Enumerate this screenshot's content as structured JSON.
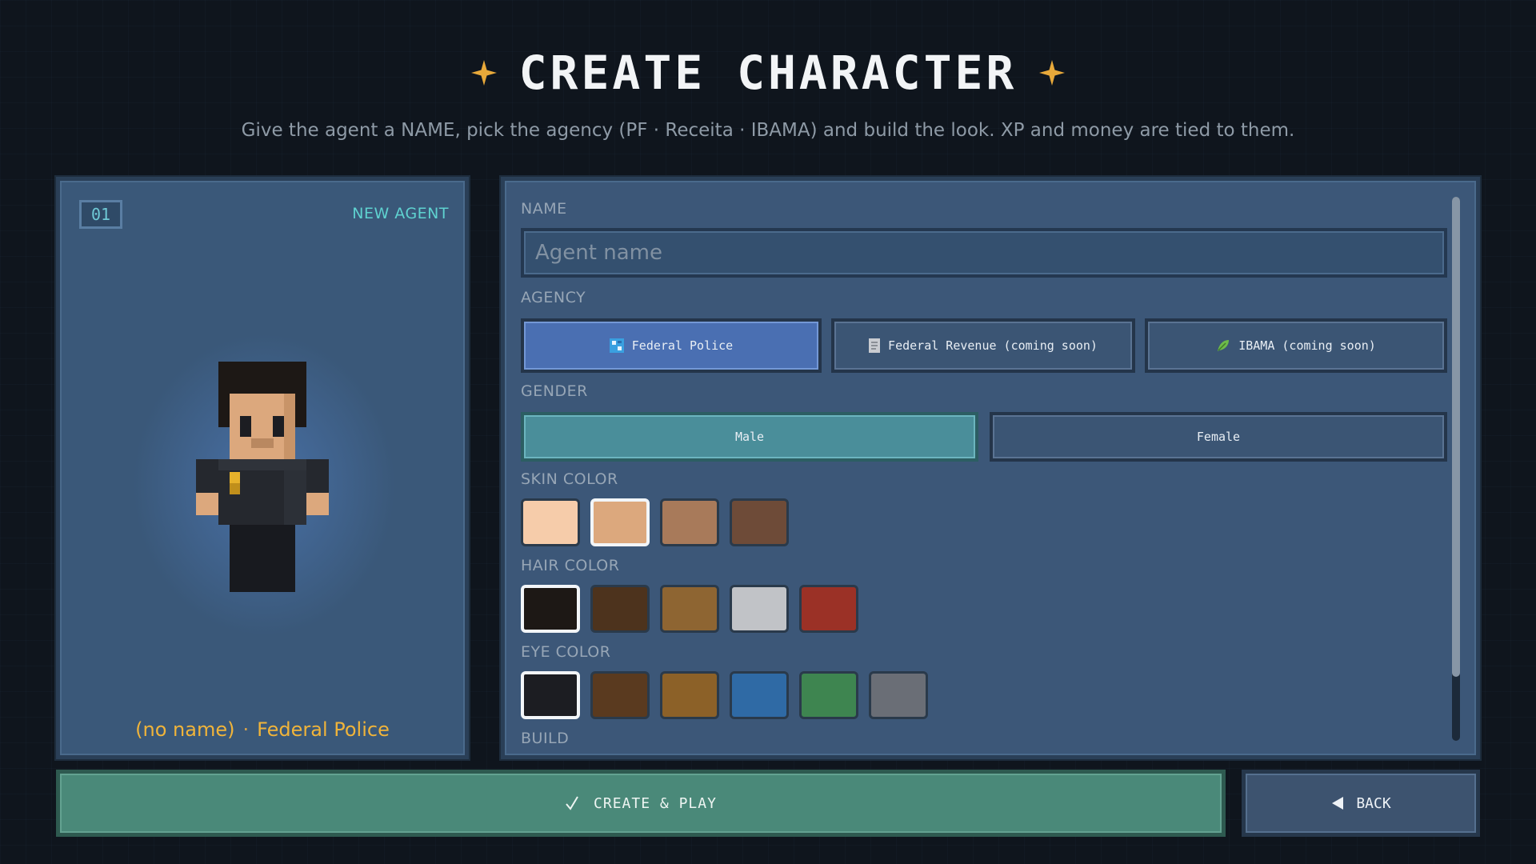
{
  "header": {
    "title": "CREATE CHARACTER",
    "subtitle": "Give the agent a NAME, pick the agency (PF · Receita · IBAMA) and build the look. XP and money are tied to them."
  },
  "preview": {
    "slot": "01",
    "tag": "NEW AGENT",
    "name_display": "(no name)",
    "separator": "·",
    "agency_display": "Federal Police"
  },
  "form": {
    "name": {
      "label": "NAME",
      "placeholder": "Agent name",
      "value": ""
    },
    "agency": {
      "label": "AGENCY",
      "options": [
        {
          "label": "Federal Police",
          "icon": "police-badge-icon",
          "selected": true
        },
        {
          "label": "Federal Revenue (coming soon)",
          "icon": "document-icon",
          "selected": false
        },
        {
          "label": "IBAMA (coming soon)",
          "icon": "leaf-icon",
          "selected": false
        }
      ]
    },
    "gender": {
      "label": "GENDER",
      "options": [
        {
          "label": "Male",
          "selected": true
        },
        {
          "label": "Female",
          "selected": false
        }
      ]
    },
    "skin_color": {
      "label": "SKIN COLOR",
      "options": [
        "#f6ccaa",
        "#dca87d",
        "#a87a5a",
        "#6e4b38"
      ],
      "selected_index": 1
    },
    "hair_color": {
      "label": "HAIR COLOR",
      "options": [
        "#1d1815",
        "#4d331d",
        "#8e6532",
        "#c1c3c7",
        "#9b3126"
      ],
      "selected_index": 0
    },
    "eye_color": {
      "label": "EYE COLOR",
      "options": [
        "#1c1d22",
        "#5a3a1f",
        "#8c6128",
        "#2f6aa5",
        "#3e8550",
        "#6a6e76"
      ],
      "selected_index": 0
    },
    "build": {
      "label": "BUILD"
    }
  },
  "actions": {
    "create": "CREATE & PLAY",
    "back": "BACK"
  },
  "colors": {
    "accent_gold": "#f0b43a",
    "accent_teal": "#5fd2d0",
    "selected_blue": "#4a6fb2",
    "selected_teal": "#4a8e9a",
    "create_green": "#4a8979"
  }
}
